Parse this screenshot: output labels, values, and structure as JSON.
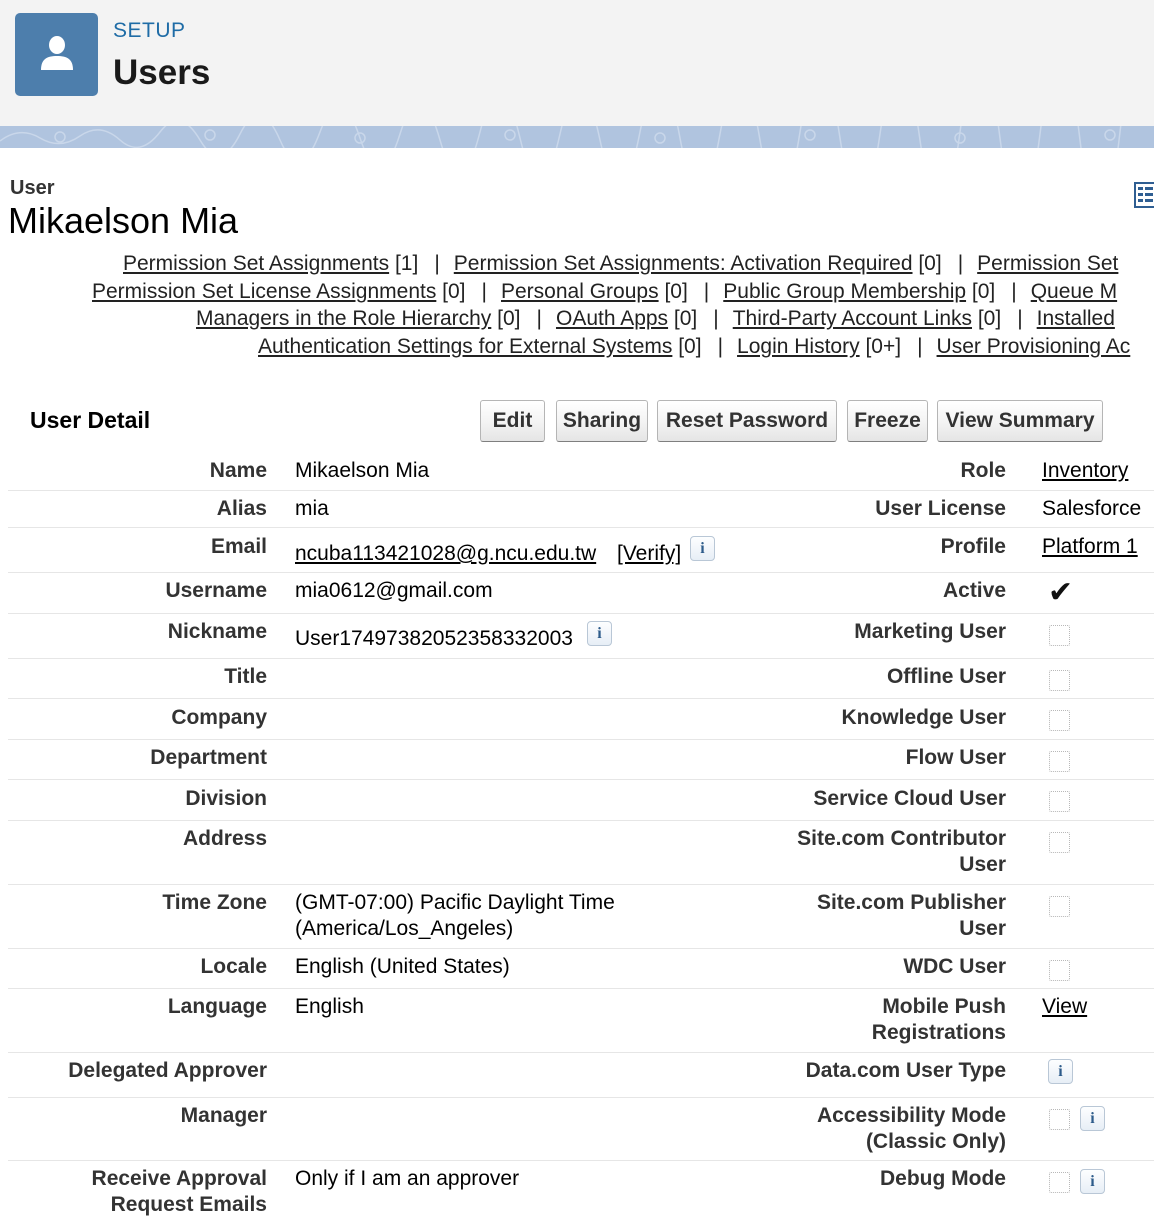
{
  "header": {
    "setup_label": "SETUP",
    "title": "Users",
    "icon": "user-icon",
    "accent_color": "#4d7eac"
  },
  "record": {
    "type_label": "User",
    "name": "Mikaelson Mia"
  },
  "related_lists": {
    "line1": [
      {
        "label": "Permission Set Assignments",
        "count": "[1]"
      },
      {
        "label": "Permission Set Assignments: Activation Required",
        "count": "[0]"
      },
      {
        "label": "Permission Set",
        "count": ""
      }
    ],
    "line2": [
      {
        "label": "Permission Set License Assignments",
        "count": "[0]"
      },
      {
        "label": "Personal Groups",
        "count": "[0]"
      },
      {
        "label": "Public Group Membership",
        "count": "[0]"
      },
      {
        "label": "Queue M",
        "count": ""
      }
    ],
    "line3": [
      {
        "label": "Managers in the Role Hierarchy",
        "count": "[0]"
      },
      {
        "label": "OAuth Apps",
        "count": "[0]"
      },
      {
        "label": "Third-Party Account Links",
        "count": "[0]"
      },
      {
        "label": "Installed",
        "count": ""
      }
    ],
    "line4": [
      {
        "label": "Authentication Settings for External Systems",
        "count": "[0]"
      },
      {
        "label": "Login History",
        "count": "[0+]"
      },
      {
        "label": "User Provisioning Ac",
        "count": ""
      }
    ]
  },
  "section": {
    "title": "User Detail",
    "buttons": {
      "edit": "Edit",
      "sharing": "Sharing",
      "reset_password": "Reset Password",
      "freeze": "Freeze",
      "view_summary": "View Summary"
    }
  },
  "fields": {
    "name": {
      "label": "Name",
      "value": "Mikaelson Mia"
    },
    "alias": {
      "label": "Alias",
      "value": "mia"
    },
    "email": {
      "label": "Email",
      "value": "ncuba113421028@g.ncu.edu.tw",
      "verify": "[Verify]"
    },
    "username": {
      "label": "Username",
      "value": "mia0612@gmail.com"
    },
    "nickname": {
      "label": "Nickname",
      "value": "User17497382052358332003"
    },
    "title": {
      "label": "Title",
      "value": ""
    },
    "company": {
      "label": "Company",
      "value": ""
    },
    "department": {
      "label": "Department",
      "value": ""
    },
    "division": {
      "label": "Division",
      "value": ""
    },
    "address": {
      "label": "Address",
      "value": ""
    },
    "time_zone": {
      "label": "Time Zone",
      "value_line1": "(GMT-07:00) Pacific Daylight Time",
      "value_line2": "(America/Los_Angeles)"
    },
    "locale": {
      "label": "Locale",
      "value": "English (United States)"
    },
    "language": {
      "label": "Language",
      "value": "English"
    },
    "delegated_approver": {
      "label": "Delegated Approver",
      "value": ""
    },
    "manager": {
      "label": "Manager",
      "value": ""
    },
    "receive_approval": {
      "label_line1": "Receive Approval",
      "label_line2": "Request Emails",
      "value": "Only if I am an approver"
    },
    "role": {
      "label": "Role",
      "value": "Inventory"
    },
    "user_license": {
      "label": "User License",
      "value": "Salesforce"
    },
    "profile": {
      "label": "Profile",
      "value": "Platform 1"
    },
    "active": {
      "label": "Active",
      "checked": true
    },
    "marketing_user": {
      "label": "Marketing User",
      "checked": false
    },
    "offline_user": {
      "label": "Offline User",
      "checked": false
    },
    "knowledge_user": {
      "label": "Knowledge User",
      "checked": false
    },
    "flow_user": {
      "label": "Flow User",
      "checked": false
    },
    "service_cloud_user": {
      "label": "Service Cloud User",
      "checked": false
    },
    "site_contributor": {
      "label_line1": "Site.com Contributor",
      "label_line2": "User",
      "checked": false
    },
    "site_publisher": {
      "label_line1": "Site.com Publisher",
      "label_line2": "User",
      "checked": false
    },
    "wdc_user": {
      "label": "WDC User",
      "checked": false
    },
    "mobile_push": {
      "label_line1": "Mobile Push",
      "label_line2": "Registrations",
      "value": "View"
    },
    "datacom_user_type": {
      "label": "Data.com User Type"
    },
    "accessibility_mode": {
      "label_line1": "Accessibility Mode",
      "label_line2": "(Classic Only)",
      "checked": false
    },
    "debug_mode": {
      "label": "Debug Mode",
      "checked": false
    }
  },
  "icons": {
    "info": "i",
    "check": "✔"
  }
}
